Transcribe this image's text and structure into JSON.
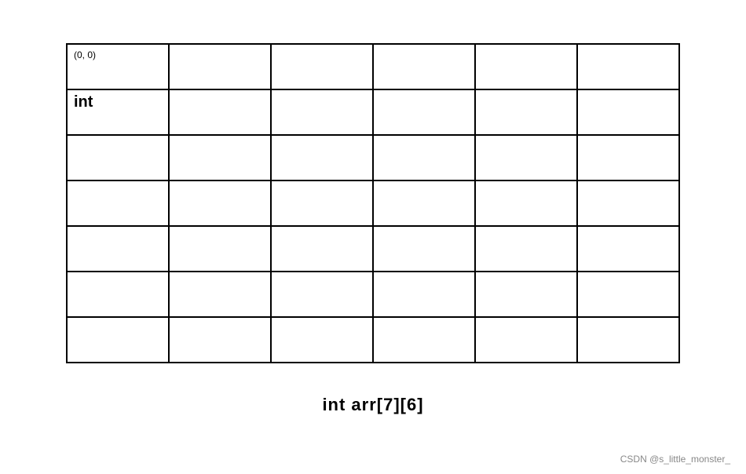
{
  "grid": {
    "rows": 7,
    "cols": 6,
    "cells": [
      [
        {
          "label": "(0, 0)",
          "bold": false
        },
        {
          "label": "",
          "bold": false
        },
        {
          "label": "",
          "bold": false
        },
        {
          "label": "",
          "bold": false
        },
        {
          "label": "",
          "bold": false
        },
        {
          "label": "",
          "bold": false
        }
      ],
      [
        {
          "label": "int",
          "bold": true,
          "is_int": true
        },
        {
          "label": "",
          "bold": false
        },
        {
          "label": "",
          "bold": false
        },
        {
          "label": "",
          "bold": false
        },
        {
          "label": "",
          "bold": false
        },
        {
          "label": "",
          "bold": false
        }
      ],
      [
        {
          "label": "",
          "bold": false
        },
        {
          "label": "",
          "bold": false
        },
        {
          "label": "",
          "bold": false
        },
        {
          "label": "",
          "bold": false
        },
        {
          "label": "",
          "bold": false
        },
        {
          "label": "",
          "bold": false
        }
      ],
      [
        {
          "label": "",
          "bold": false
        },
        {
          "label": "",
          "bold": false
        },
        {
          "label": "",
          "bold": false
        },
        {
          "label": "",
          "bold": false
        },
        {
          "label": "",
          "bold": false
        },
        {
          "label": "",
          "bold": false
        }
      ],
      [
        {
          "label": "",
          "bold": false
        },
        {
          "label": "",
          "bold": false
        },
        {
          "label": "",
          "bold": false
        },
        {
          "label": "",
          "bold": false
        },
        {
          "label": "",
          "bold": false
        },
        {
          "label": "",
          "bold": false
        }
      ],
      [
        {
          "label": "",
          "bold": false
        },
        {
          "label": "",
          "bold": false
        },
        {
          "label": "",
          "bold": false
        },
        {
          "label": "",
          "bold": false
        },
        {
          "label": "",
          "bold": false
        },
        {
          "label": "",
          "bold": false
        }
      ],
      [
        {
          "label": "",
          "bold": false
        },
        {
          "label": "",
          "bold": false
        },
        {
          "label": "",
          "bold": false
        },
        {
          "label": "",
          "bold": false
        },
        {
          "label": "",
          "bold": false
        },
        {
          "label": "",
          "bold": false
        }
      ]
    ]
  },
  "caption": {
    "text": "int arr[7][6]"
  },
  "watermark": {
    "text": "CSDN @s_little_monster_"
  }
}
